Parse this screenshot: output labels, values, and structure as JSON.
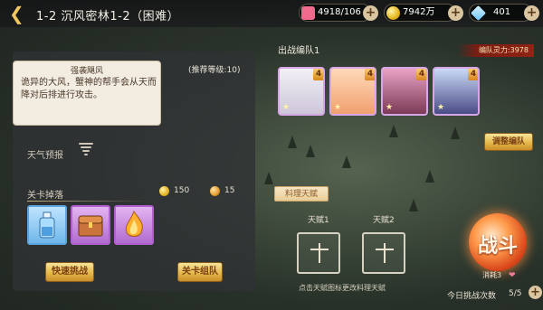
{
  "header": {
    "title": "1-2 沉风密林1-2（困难）",
    "resources": [
      {
        "name": "stamina",
        "icon": "heart-icon",
        "value": "4918/106",
        "color": "#f06a8e"
      },
      {
        "name": "gold",
        "icon": "coin-icon",
        "value": "7942万",
        "color": "#f2c23a"
      },
      {
        "name": "diamond",
        "icon": "diamond-icon",
        "value": "401",
        "color": "#8fd6ff"
      }
    ]
  },
  "left": {
    "tooltip": {
      "title": "强袭飓风",
      "body": "诡异的大风，蟹神的帮手会从天而降对后排进行攻击。"
    },
    "recommended_level": "(推荐等级:10)",
    "weather_label": "天气预报",
    "drops": {
      "label": "关卡掉落",
      "gold": "150",
      "exp": "15",
      "items": [
        {
          "icon": "potion-bottle-icon",
          "frame": "#5ba4e0"
        },
        {
          "icon": "treasure-chest-icon",
          "frame": "#b05fd0"
        },
        {
          "icon": "golden-flame-icon",
          "frame": "#b05fd0"
        }
      ]
    },
    "buttons": {
      "quick": "快速挑战",
      "info": "关卡组队"
    }
  },
  "right": {
    "team_label": "出战编队1",
    "team_power": "编队灵力:3978",
    "portraits": [
      {
        "badge": "4",
        "stars": "★"
      },
      {
        "badge": "4",
        "stars": "★"
      },
      {
        "badge": "4",
        "stars": "★"
      },
      {
        "badge": "4",
        "stars": "★"
      }
    ],
    "adjust_button": "调整编队",
    "cooking_tab": "料理天赋",
    "talents": [
      {
        "label": "天赋1"
      },
      {
        "label": "天赋2"
      }
    ],
    "talent_hint": "点击天赋图标更改料理天赋",
    "battle_button": "战斗",
    "cost_label": "消耗3",
    "daily_label": "今日挑战次数",
    "daily_count": "5/5"
  }
}
